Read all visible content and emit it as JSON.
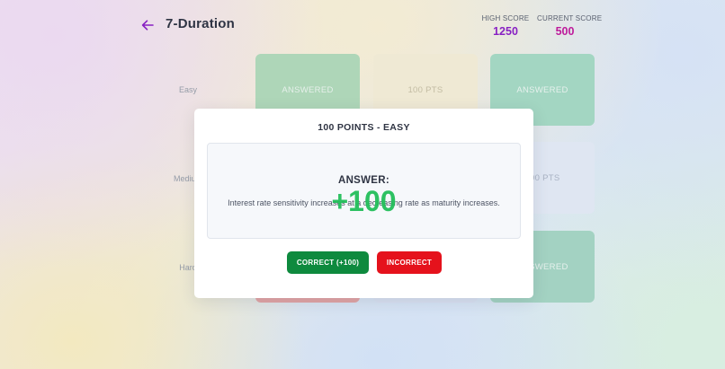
{
  "header": {
    "title": "7-Duration",
    "back_icon": "arrow-left-icon",
    "high_score_label": "HIGH SCORE",
    "high_score_value": "1250",
    "current_score_label": "CURRENT SCORE",
    "current_score_value": "500"
  },
  "board": {
    "rows": [
      {
        "label": "Easy"
      },
      {
        "label": "Medium"
      },
      {
        "label": "Hard"
      }
    ],
    "tiles": {
      "easy_1": "ANSWERED",
      "easy_2": "100 PTS",
      "easy_3": "ANSWERED",
      "medium_3": "200 PTS",
      "hard_3": "ANSWERED"
    }
  },
  "modal": {
    "title": "100 POINTS - EASY",
    "answer_heading": "ANSWER:",
    "answer_text": "Interest rate sensitivity increases at a decreasing rate as maturity increases.",
    "points_popup": "+100",
    "correct_label": "CORRECT (+100)",
    "incorrect_label": "INCORRECT"
  },
  "colors": {
    "high_score": "#8c1fc7",
    "current_score": "#c4189e",
    "correct_button": "#0e8a3e",
    "incorrect_button": "#e5121c",
    "points_popup": "#22be5a"
  }
}
